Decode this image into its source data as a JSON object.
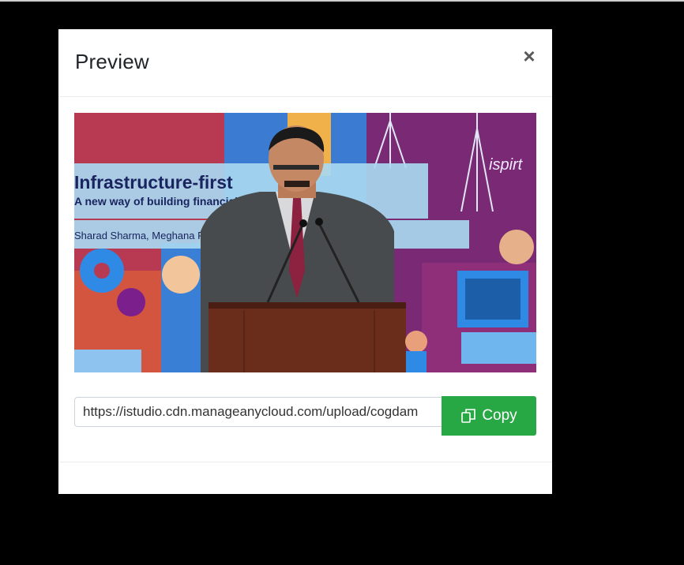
{
  "modal": {
    "title": "Preview",
    "close_icon": "close-icon",
    "close_glyph": "×"
  },
  "preview": {
    "slide_title": "Infrastructure-first",
    "slide_subtitle": "A new way of building financial products for India",
    "slide_authors": "Sharad Sharma, Meghana Reddy, iSPIRT Foundation",
    "slide_logo": "ispirt"
  },
  "url_field": {
    "value": "https://istudio.cdn.manageanycloud.com/upload/cogdam"
  },
  "copy_button": {
    "label": "Copy",
    "icon": "copy-icon",
    "color": "#28a745"
  }
}
